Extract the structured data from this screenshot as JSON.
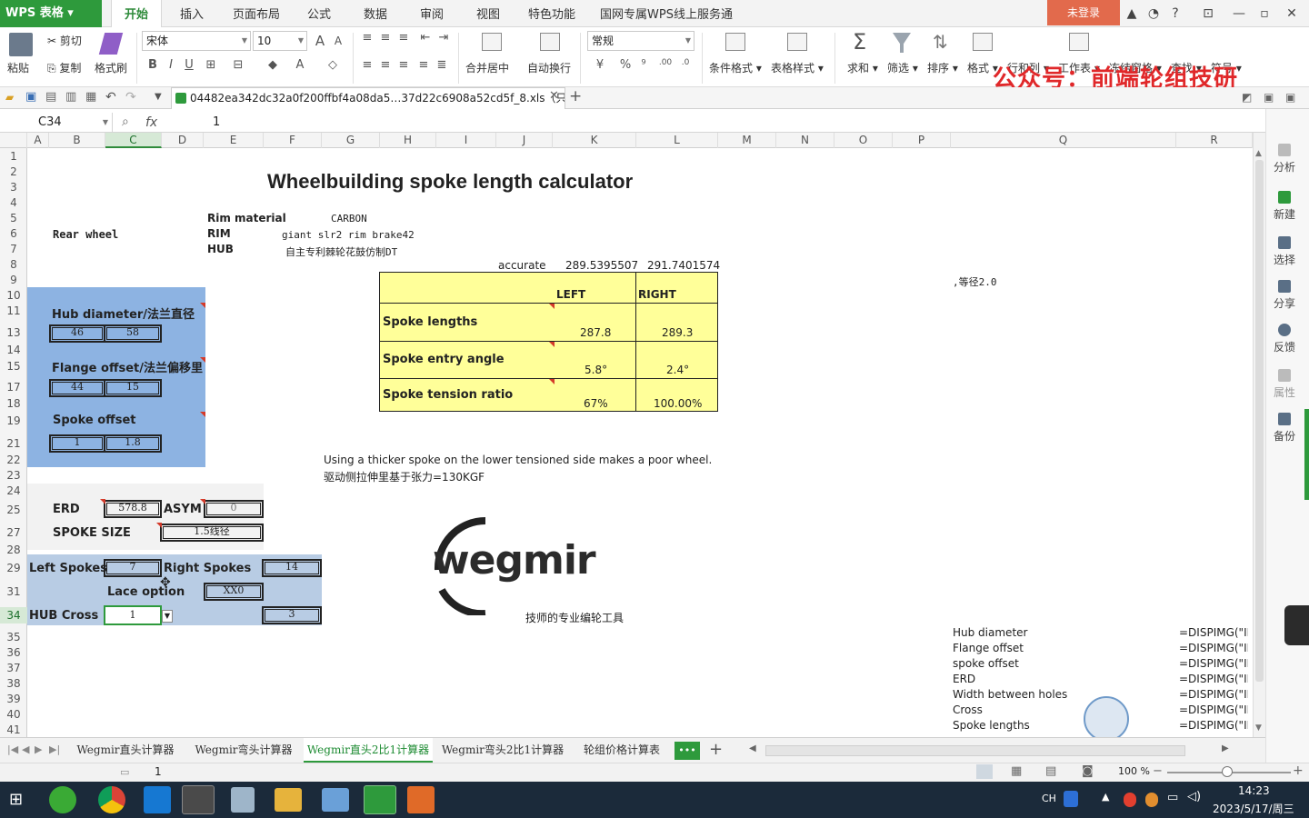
{
  "app": {
    "name": "WPS 表格",
    "login_label": "未登录"
  },
  "menu": {
    "tabs": [
      "开始",
      "插入",
      "页面布局",
      "公式",
      "数据",
      "审阅",
      "视图",
      "特色功能",
      "国网专属WPS线上服务通道"
    ]
  },
  "ribbon": {
    "paste": "粘贴",
    "cut": "剪切",
    "copy": "复制",
    "format_painter": "格式刷",
    "font_name": "宋体",
    "font_size": "10",
    "merge_center": "合并居中",
    "wrap_text": "自动换行",
    "number_format": "常规",
    "cond_format": "条件格式",
    "table_style": "表格样式",
    "sum": "求和",
    "filter": "筛选",
    "sort": "排序",
    "format": "格式",
    "row_col": "行和列",
    "worksheet": "工作表",
    "freeze": "冻结窗格",
    "find": "查找",
    "symbol": "符号",
    "percent": "%",
    "thousands": "⁹"
  },
  "watermark": "公众号：前端轮组技研",
  "document": {
    "tab_title": "04482ea342dc32a0f200ffbf4a08da5…37d22c6908a52cd5f_8.xls（只读）*"
  },
  "formula_bar": {
    "name_box": "C34",
    "fx": "fx",
    "value": "1"
  },
  "columns": [
    "A",
    "B",
    "C",
    "D",
    "E",
    "F",
    "G",
    "H",
    "I",
    "J",
    "K",
    "L",
    "M",
    "N",
    "O",
    "P",
    "Q",
    "R"
  ],
  "rows": [
    "1",
    "2",
    "3",
    "4",
    "5",
    "6",
    "7",
    "8",
    "9",
    "10",
    "11",
    "13",
    "14",
    "15",
    "17",
    "18",
    "19",
    "21",
    "22",
    "23",
    "24",
    "25",
    "27",
    "28",
    "29",
    "31",
    "34",
    "35",
    "36",
    "37",
    "38",
    "39",
    "40",
    "41"
  ],
  "sheet": {
    "title": "Wheelbuilding spoke length calculator",
    "rear_wheel": "Rear wheel",
    "rim_material_label": "Rim material",
    "rim_material_value": "CARBON",
    "rim_label": "RIM",
    "rim_value": "giant slr2 rim brake42",
    "hub_label": "HUB",
    "hub_value": "自主专利棘轮花鼓仿制DT",
    "accurate_label": "accurate",
    "accurate_left": "289.5395507",
    "accurate_right": "291.7401574",
    "note_right": ",等径2.0",
    "result_left_header": "LEFT",
    "result_right_header": "RIGHT",
    "spoke_lengths_label": "Spoke lengths",
    "spoke_lengths_left": "287.8",
    "spoke_lengths_right": "289.3",
    "entry_angle_label": "Spoke entry angle",
    "entry_angle_left": "5.8°",
    "entry_angle_right": "2.4°",
    "tension_label": "Spoke tension ratio",
    "tension_left": "67%",
    "tension_right": "100.00%",
    "hub_diameter_label": "Hub diameter/法兰直径",
    "hub_diameter_left": "46",
    "hub_diameter_right": "58",
    "flange_offset_label": "Flange offset/法兰偏移里",
    "flange_offset_left": "44",
    "flange_offset_right": "15",
    "spoke_offset_label": "Spoke offset",
    "spoke_offset_left": "1",
    "spoke_offset_right": "1.8",
    "erd_label": "ERD",
    "erd_value": "578.8",
    "asym_label": "ASYM",
    "asym_value": "0",
    "spoke_size_label": "SPOKE SIZE",
    "spoke_size_value": "1.5线径",
    "left_spokes_label": "Left Spokes",
    "left_spokes_value": "7",
    "right_spokes_label": "Right Spokes",
    "right_spokes_value": "14",
    "lace_option_label": "Lace option",
    "lace_option_value": "XX0",
    "hub_cross_label": "HUB Cross",
    "hub_cross_left": "1",
    "hub_cross_right": "3",
    "note_line1": "Using a thicker spoke on the lower tensioned side makes a poor wheel.",
    "note_line2": "驱动侧拉伸里基于张力=130KGF",
    "logo_text": "wegmir",
    "logo_caption": "技师的专业编轮工具",
    "formula_list": [
      {
        "name": "Hub diameter",
        "formula": "=DISPIMG(\"II"
      },
      {
        "name": "Flange offset",
        "formula": "=DISPIMG(\"II"
      },
      {
        "name": "spoke offset",
        "formula": "=DISPIMG(\"II"
      },
      {
        "name": "ERD",
        "formula": "=DISPIMG(\"II"
      },
      {
        "name": "Width between holes",
        "formula": "=DISPIMG(\"II"
      },
      {
        "name": "Cross",
        "formula": "=DISPIMG(\"II"
      },
      {
        "name": "Spoke lengths",
        "formula": "=DISPIMG(\"II"
      }
    ]
  },
  "sidebar": {
    "items": [
      "分析",
      "新建",
      "选择",
      "分享",
      "反馈",
      "属性",
      "备份"
    ]
  },
  "sheet_tabs": {
    "tabs": [
      "Wegmir直头计算器",
      "Wegmir弯头计算器",
      "Wegmir直头2比1计算器",
      "Wegmir弯头2比1计算器",
      "轮组价格计算表"
    ],
    "more": "•••",
    "add": "+"
  },
  "status": {
    "value": "1",
    "zoom": "100 %"
  },
  "taskbar": {
    "ime": "CH",
    "time": "14:23",
    "date": "2023/5/17/周三"
  },
  "colors": {
    "accent": "#2e9a3c",
    "input_panel": "#8db3e2",
    "result_panel": "#ffff99",
    "watermark": "#e0282a"
  }
}
